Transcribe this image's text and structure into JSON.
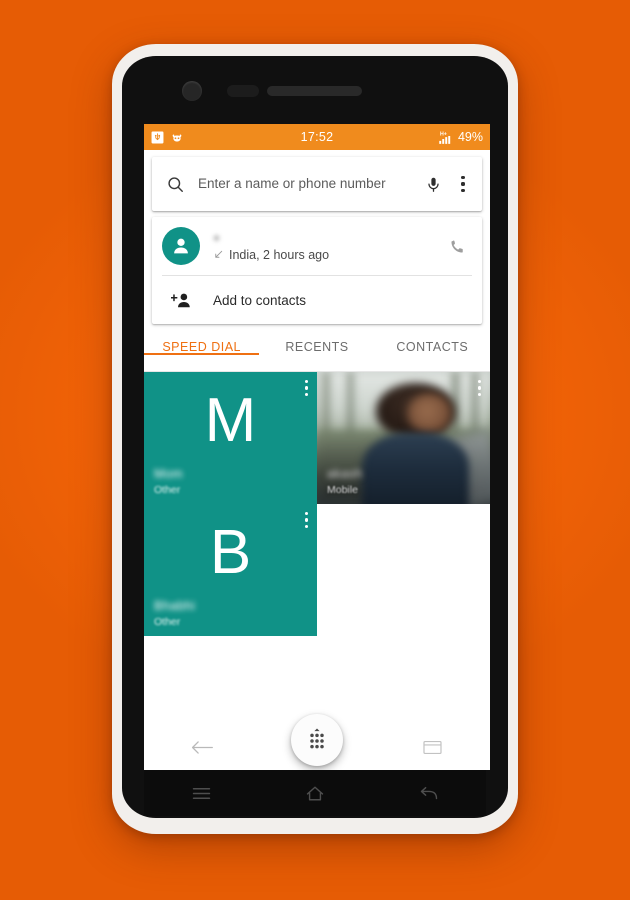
{
  "statusbar": {
    "time": "17:52",
    "battery": "49%",
    "network_type": "H+",
    "left_icons": [
      "usb-debug-icon",
      "cyanogenmod-icon"
    ],
    "right_icons": [
      "signal-bars-icon",
      "battery-percent"
    ]
  },
  "search": {
    "placeholder": "Enter a name or phone number",
    "icons": [
      "search-icon",
      "mic-icon",
      "overflow-menu-icon"
    ]
  },
  "suggestion": {
    "number": "+",
    "subtitle": "India, 2 hours ago",
    "call_type": "incoming",
    "add_contact_label": "Add to contacts",
    "avatar_color": "#109287"
  },
  "tabs": [
    {
      "label": "SPEED DIAL",
      "active": true
    },
    {
      "label": "RECENTS",
      "active": false
    },
    {
      "label": "CONTACTS",
      "active": false
    }
  ],
  "speed_dial": [
    {
      "letter": "M",
      "name": "Mom",
      "type": "Other",
      "kind": "letter"
    },
    {
      "letter": "",
      "name": "akash",
      "type": "Mobile",
      "kind": "photo"
    },
    {
      "letter": "B",
      "name": "Bhabhi",
      "type": "Other",
      "kind": "letter"
    },
    {
      "letter": "",
      "name": "",
      "type": "",
      "kind": "empty"
    }
  ],
  "fab": {
    "name": "dialpad-button"
  },
  "navbar": [
    "back-icon",
    "home-icon",
    "recents-icon"
  ],
  "hardware_keys": [
    "menu-key",
    "home-key",
    "back-key"
  ],
  "colors": {
    "accent_orange": "#ef7012",
    "status_orange": "#f08b1d",
    "background_orange": "#f26307",
    "teal": "#109287"
  }
}
